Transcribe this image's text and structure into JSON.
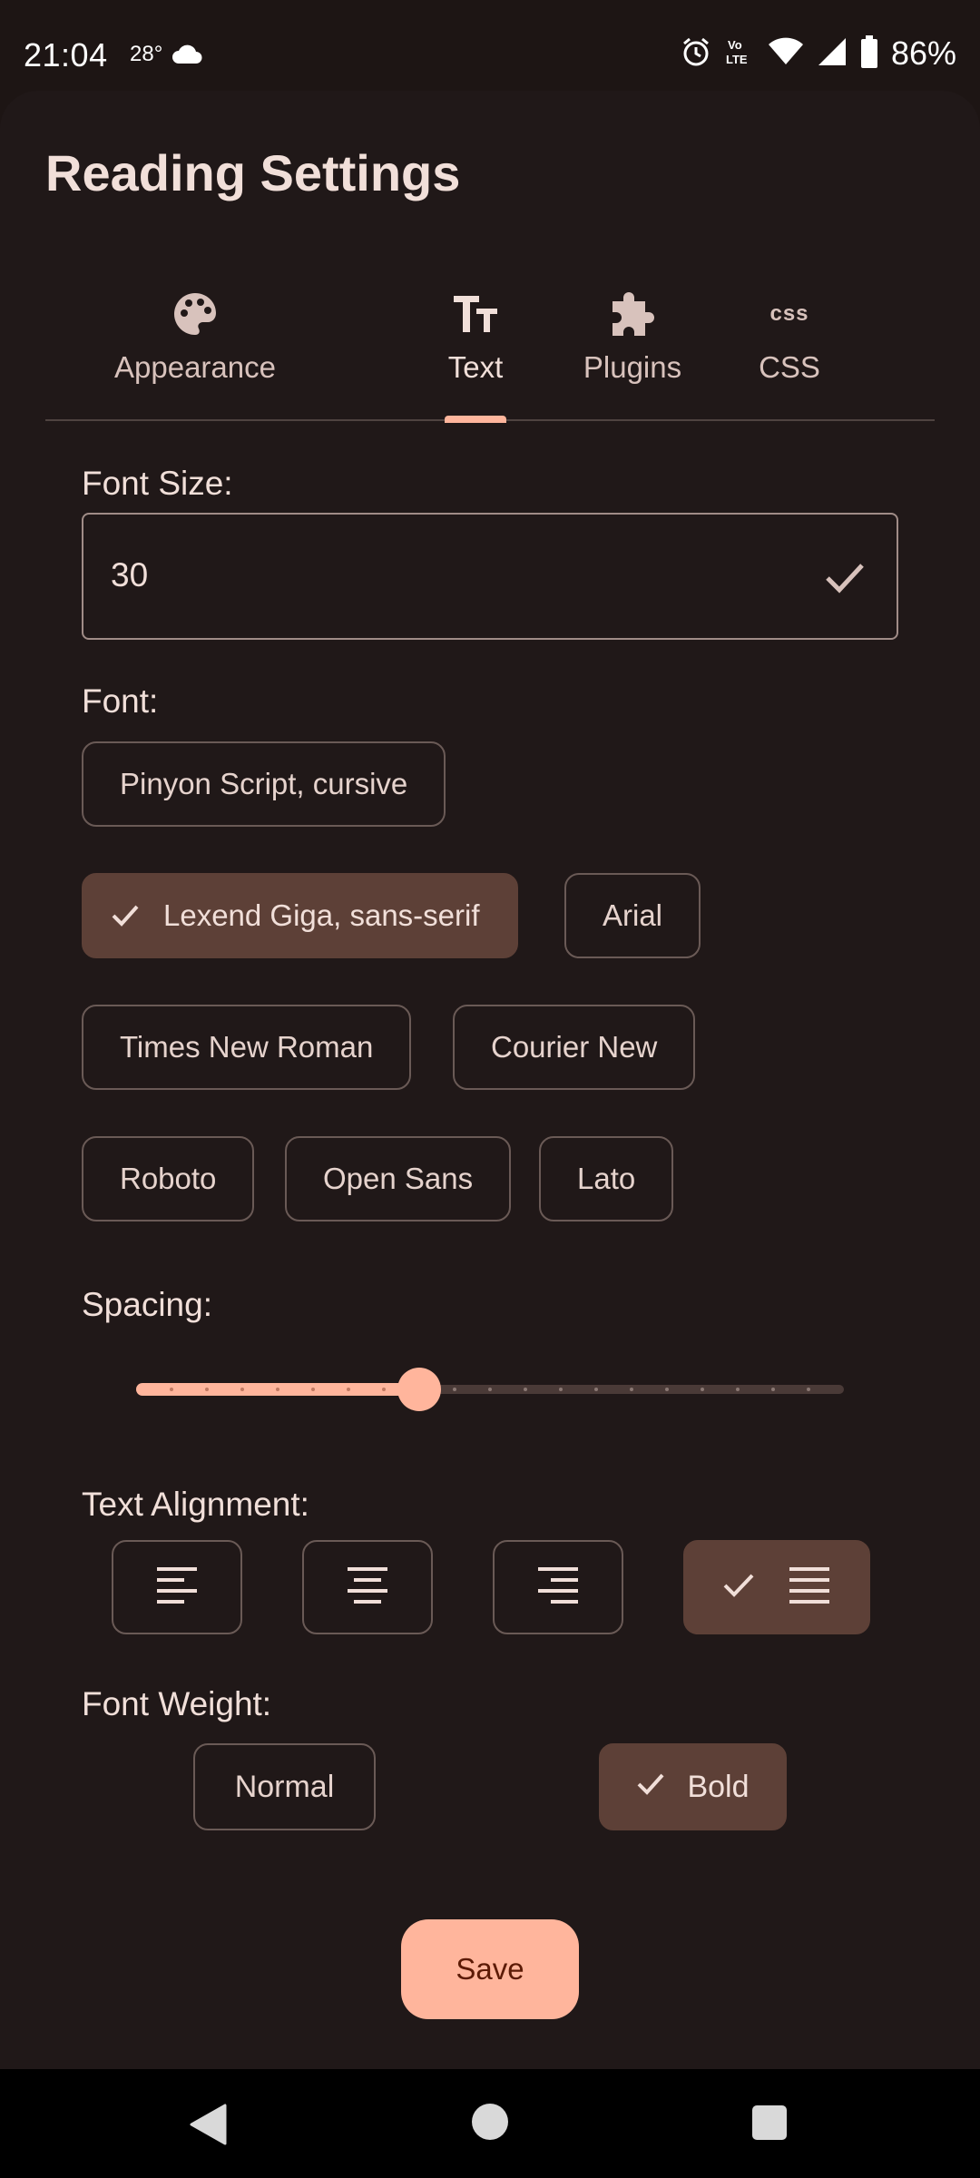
{
  "status_bar": {
    "time": "21:04",
    "temperature": "28°",
    "battery": "86%",
    "icons": [
      "cloud-icon",
      "alarm-icon",
      "volte-icon",
      "wifi-icon",
      "signal-icon",
      "battery-icon"
    ]
  },
  "page": {
    "title": "Reading Settings"
  },
  "tabs": [
    {
      "label": "Appearance",
      "icon": "palette-icon",
      "active": false
    },
    {
      "label": "Text",
      "icon": "text-format-icon",
      "active": true
    },
    {
      "label": "Plugins",
      "icon": "puzzle-icon",
      "active": false
    },
    {
      "label": "CSS",
      "icon": "css-icon",
      "active": false
    }
  ],
  "css_icon_text": "css",
  "font_size": {
    "label": "Font Size:",
    "value": "30"
  },
  "font": {
    "label": "Font:",
    "options": [
      "Pinyon Script, cursive",
      "Lexend Giga, sans-serif",
      "Arial",
      "Times New Roman",
      "Courier New",
      "Roboto",
      "Open Sans",
      "Lato"
    ],
    "selected": "Lexend Giga, sans-serif"
  },
  "spacing": {
    "label": "Spacing:",
    "steps": 20,
    "value_step": 8
  },
  "text_alignment": {
    "label": "Text Alignment:",
    "options": [
      "left",
      "center",
      "right",
      "justify"
    ],
    "selected": "justify"
  },
  "font_weight": {
    "label": "Font Weight:",
    "options": [
      "Normal",
      "Bold"
    ],
    "selected": "Bold"
  },
  "actions": {
    "save_label": "Save"
  },
  "colors": {
    "background": "#201818",
    "accent": "#ffb59c",
    "selected_chip": "#5d4037"
  }
}
